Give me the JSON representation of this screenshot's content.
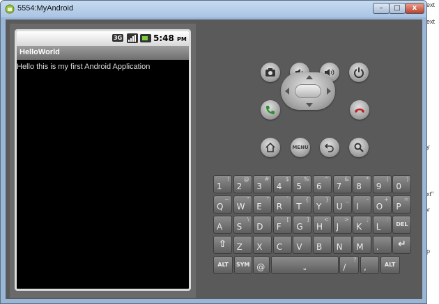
{
  "window": {
    "title": "5554:MyAndroid",
    "controls": {
      "minimize": "–",
      "maximize": "□",
      "close": "x"
    }
  },
  "background": {
    "snippets": [
      "ext",
      "ext",
      "v",
      "xt\"",
      "y",
      "p"
    ]
  },
  "device": {
    "status_bar": {
      "network": "3G",
      "time": "5:48",
      "ampm": "PM"
    },
    "app_title": "HelloWorld",
    "content_text": "Hello this is my first Android Application"
  },
  "hardware_buttons": {
    "menu_label": "MENU",
    "items": [
      "camera",
      "volume-down",
      "volume-up",
      "power",
      "call",
      "dpad",
      "end-call",
      "home",
      "menu",
      "back",
      "search"
    ]
  },
  "keyboard": {
    "rows": [
      [
        {
          "m": "1",
          "s": "!"
        },
        {
          "m": "2",
          "s": "@"
        },
        {
          "m": "3",
          "s": "#"
        },
        {
          "m": "4",
          "s": "$"
        },
        {
          "m": "5",
          "s": "%"
        },
        {
          "m": "6",
          "s": "^"
        },
        {
          "m": "7",
          "s": "&"
        },
        {
          "m": "8",
          "s": "*"
        },
        {
          "m": "9",
          "s": "("
        },
        {
          "m": "0",
          "s": ")"
        }
      ],
      [
        {
          "m": "Q",
          "s": "~"
        },
        {
          "m": "W",
          "s": "\""
        },
        {
          "m": "E",
          "s": "\""
        },
        {
          "m": "R",
          "s": "`"
        },
        {
          "m": "T",
          "s": "{"
        },
        {
          "m": "Y",
          "s": "}"
        },
        {
          "m": "U",
          "s": "_"
        },
        {
          "m": "I",
          "s": "-"
        },
        {
          "m": "O",
          "s": "+"
        },
        {
          "m": "P",
          "s": "="
        }
      ],
      [
        {
          "m": "A",
          "s": ""
        },
        {
          "m": "S",
          "s": "\\"
        },
        {
          "m": "D",
          "s": ""
        },
        {
          "m": "F",
          "s": "["
        },
        {
          "m": "G",
          "s": "]"
        },
        {
          "m": "H",
          "s": "<"
        },
        {
          "m": "J",
          "s": ">"
        },
        {
          "m": "K",
          "s": ";"
        },
        {
          "m": "L",
          "s": ":"
        },
        {
          "m": "DEL",
          "s": ""
        }
      ],
      [
        {
          "m": "SHIFT",
          "s": ""
        },
        {
          "m": "Z",
          "s": ""
        },
        {
          "m": "X",
          "s": ""
        },
        {
          "m": "C",
          "s": ""
        },
        {
          "m": "V",
          "s": ""
        },
        {
          "m": "B",
          "s": ""
        },
        {
          "m": "N",
          "s": ""
        },
        {
          "m": "M",
          "s": ""
        },
        {
          "m": ".",
          "s": ""
        },
        {
          "m": "ENTER",
          "s": ""
        }
      ],
      [
        {
          "m": "ALT",
          "s": ""
        },
        {
          "m": "SYM",
          "s": ""
        },
        {
          "m": "@",
          "s": ""
        },
        {
          "m": "SPACE",
          "s": ""
        },
        {
          "m": "/",
          "s": "?"
        },
        {
          "m": ",",
          "s": ""
        },
        {
          "m": "ALT",
          "s": ""
        }
      ]
    ]
  }
}
